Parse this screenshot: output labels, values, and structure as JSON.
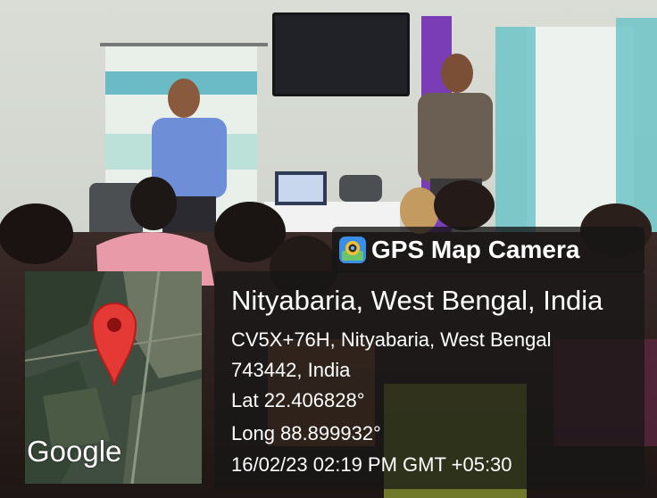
{
  "badge": {
    "title": "GPS Map Camera",
    "icon": "gps-map-camera-app-icon"
  },
  "map": {
    "logo": "Google",
    "pin_color": "#e53935",
    "pin_icon": "map-pin-icon"
  },
  "location": {
    "place": "Nityabaria, West Bengal, India",
    "address_line1": "CV5X+76H, Nityabaria, West Bengal",
    "address_line2": "743442, India",
    "latitude": "Lat 22.406828°",
    "longitude": "Long 88.899932°",
    "timestamp": "16/02/23 02:19 PM GMT +05:30"
  },
  "colors": {
    "overlay": "#161616",
    "accent_wall": "#7a3db5",
    "pink_top": "#e89aa8"
  }
}
